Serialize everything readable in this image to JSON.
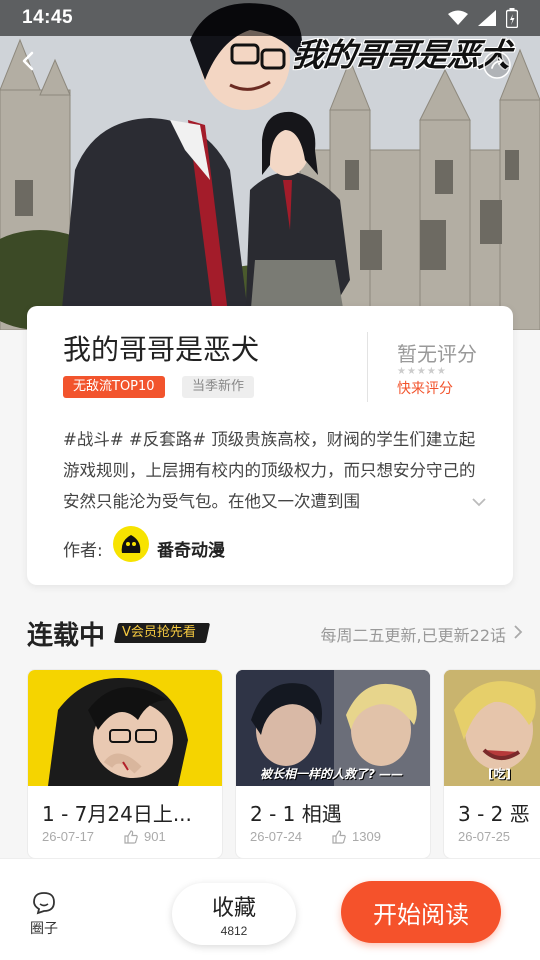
{
  "status_bar": {
    "time": "14:45"
  },
  "hero": {
    "logo_text": "我的哥哥是恶犬"
  },
  "comic": {
    "title": "我的哥哥是恶犬",
    "tags": [
      "无敌流TOP10",
      "当季新作"
    ],
    "rating_title": "暂无评分",
    "rating_link": "快来评分",
    "description": "#战斗# #反套路# 顶级贵族高校，财阀的学生们建立起游戏规则，上层拥有校内的顶级权力，而只想安分守己的安然只能沦为受气包。在他又一次遭到围",
    "author_label": "作者:",
    "author_name": "番奇动漫"
  },
  "section": {
    "title": "连载中",
    "vip_badge": "V会员抢先看",
    "update_info": "每周二五更新,已更新22话"
  },
  "episodes": [
    {
      "title": "1 - 7月24日上...",
      "date": "26-07-17",
      "likes": "901"
    },
    {
      "title": "2 - 1 相遇",
      "date": "26-07-24",
      "likes": "1309"
    },
    {
      "title": "3 - 2 恶",
      "date": "26-07-25",
      "likes": ""
    }
  ],
  "episode_thumb_captions": [
    "被长相一样的人救了? ——",
    "[吃]"
  ],
  "bottom_bar": {
    "circle_label": "圈子",
    "favorite_label": "收藏",
    "favorite_count": "4812",
    "read_label": "开始阅读"
  },
  "colors": {
    "accent": "#f5522b",
    "tag_hot": "#f2542d",
    "vip_gold": "#f5c940",
    "author_avatar": "#f7e300"
  },
  "icons": [
    "back-arrow-icon",
    "share-icon",
    "wifi-icon",
    "signal-icon",
    "battery-icon",
    "chevron-right-icon",
    "chevron-down-icon",
    "thumb-up-icon",
    "circle-community-icon"
  ]
}
